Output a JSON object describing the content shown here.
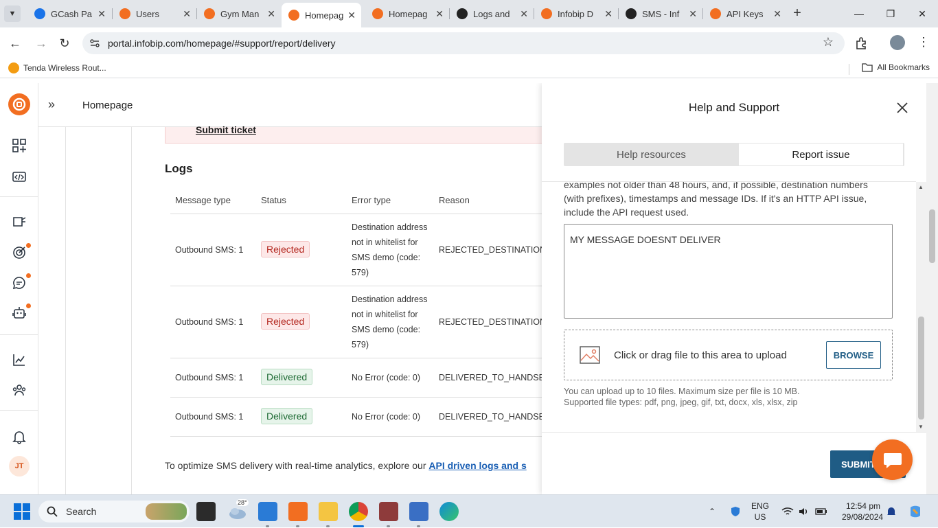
{
  "browser": {
    "tabs": [
      {
        "title": "GCash Pa",
        "favicon_color": "#1a73e8"
      },
      {
        "title": "Users",
        "favicon_color": "#f26e21"
      },
      {
        "title": "Gym Man",
        "favicon_color": "#f26e21"
      },
      {
        "title": "Homepag",
        "favicon_color": "#f26e21",
        "active": true
      },
      {
        "title": "Homepag",
        "favicon_color": "#f26e21"
      },
      {
        "title": "Logs and",
        "favicon_color": "#222222"
      },
      {
        "title": "Infobip D",
        "favicon_color": "#f26e21"
      },
      {
        "title": "SMS - Inf",
        "favicon_color": "#222222"
      },
      {
        "title": "API Keys",
        "favicon_color": "#f26e21"
      }
    ],
    "url": "portal.infobip.com/homepage/#support/report/delivery",
    "bookmarks": {
      "item": "Tenda Wireless Rout...",
      "all": "All Bookmarks"
    }
  },
  "page": {
    "header_title": "Homepage",
    "alert_link": "Submit ticket",
    "logs": {
      "title": "Logs",
      "columns": [
        "Message type",
        "Status",
        "Error type",
        "Reason"
      ],
      "rows": [
        {
          "type": "Outbound SMS: 1",
          "status": "Rejected",
          "error": "Destination address not in whitelist for SMS demo (code: 579)",
          "reason": "REJECTED_DESTINATION_"
        },
        {
          "type": "Outbound SMS: 1",
          "status": "Rejected",
          "error": "Destination address not in whitelist for SMS demo (code: 579)",
          "reason": "REJECTED_DESTINATION_"
        },
        {
          "type": "Outbound SMS: 1",
          "status": "Delivered",
          "error": "No Error (code: 0)",
          "reason": "DELIVERED_TO_HANDSET"
        },
        {
          "type": "Outbound SMS: 1",
          "status": "Delivered",
          "error": "No Error (code: 0)",
          "reason": "DELIVERED_TO_HANDSET"
        }
      ]
    },
    "bottom_text": "To optimize SMS delivery with real-time analytics, explore our ",
    "bottom_link": "API driven logs and s"
  },
  "help_panel": {
    "title": "Help and Support",
    "tabs": {
      "resources": "Help resources",
      "report": "Report issue"
    },
    "description": "examples not older than 48 hours, and, if possible, destination numbers (with prefixes), timestamps and message IDs. If it's an HTTP API issue, include the API request used.",
    "textarea_value": "MY MESSAGE DOESNT DELIVER",
    "upload_text": "Click or drag file to this area to upload",
    "browse_label": "BROWSE",
    "hint_line1": "You can upload up to 10 files. Maximum size per file is 10 MB.",
    "hint_line2": "Supported file types: pdf, png, jpeg, gif, txt, docx, xls, xlsx, zip",
    "submit_label": "SUBMIT"
  },
  "user": {
    "initials": "JT"
  },
  "taskbar": {
    "search_label": "Search",
    "weather_temp": "28°",
    "lang_line1": "ENG",
    "lang_line2": "US",
    "time": "12:54 pm",
    "date": "29/08/2024"
  },
  "colors": {
    "brand": "#f26e21",
    "primary": "#1f5c85",
    "rejected": "#b3261e",
    "delivered": "#1e6b34"
  }
}
